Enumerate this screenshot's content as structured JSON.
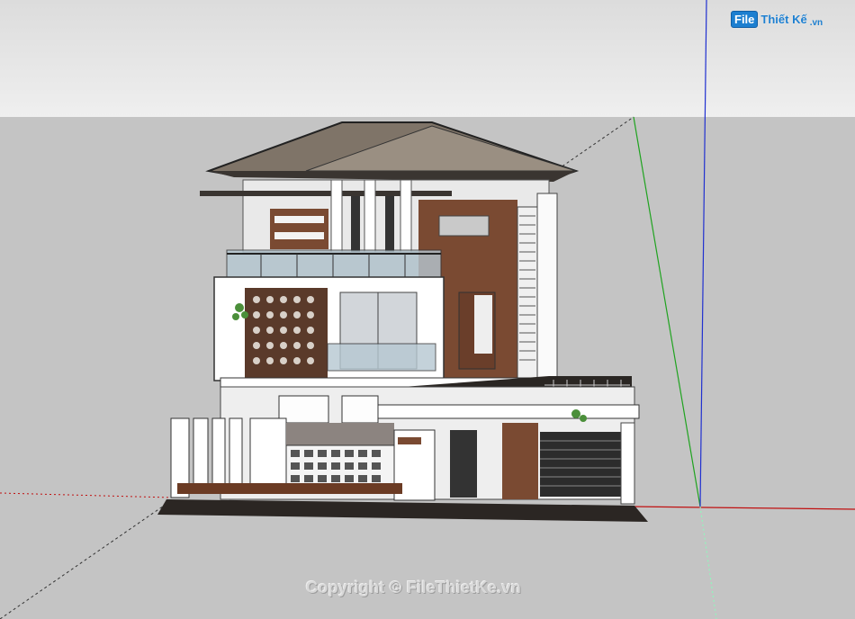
{
  "watermark": {
    "logo_badge": "File",
    "logo_text": "Thiết Kế",
    "logo_tld": ".vn",
    "copyright": "Copyright © FileThietKe.vn"
  },
  "scene": {
    "subject": "3-storey modern villa 3D model",
    "colors": {
      "sky": "#e6e6e6",
      "ground": "#c4c4c4",
      "roof": "#8a7f74",
      "wall": "#ffffff",
      "wood": "#7a4a32",
      "axis_red": "#c01010",
      "axis_green": "#1fa31f",
      "axis_blue": "#2030d0"
    }
  }
}
